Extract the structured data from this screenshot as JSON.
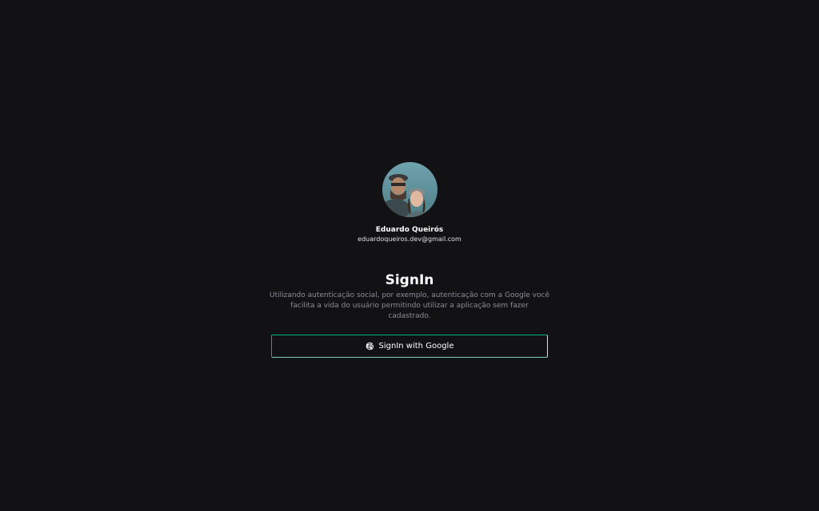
{
  "profile": {
    "name": "Eduardo Queirós",
    "email": "eduardoqueiros.dev@gmail.com",
    "avatar_icon": "avatar-photo"
  },
  "signin": {
    "title": "SignIn",
    "description": "Utilizando autenticação social, por exemplo, autenticação com a Google você facilita a vida do usuário permitindo utilizar a aplicação sem fazer cadastrado.",
    "google_button_label": "SignIn with Google",
    "google_icon": "google-icon"
  },
  "colors": {
    "background": "#121214",
    "text_primary": "#ffffff",
    "text_muted": "#8d8d99",
    "accent": "#00b37e"
  }
}
